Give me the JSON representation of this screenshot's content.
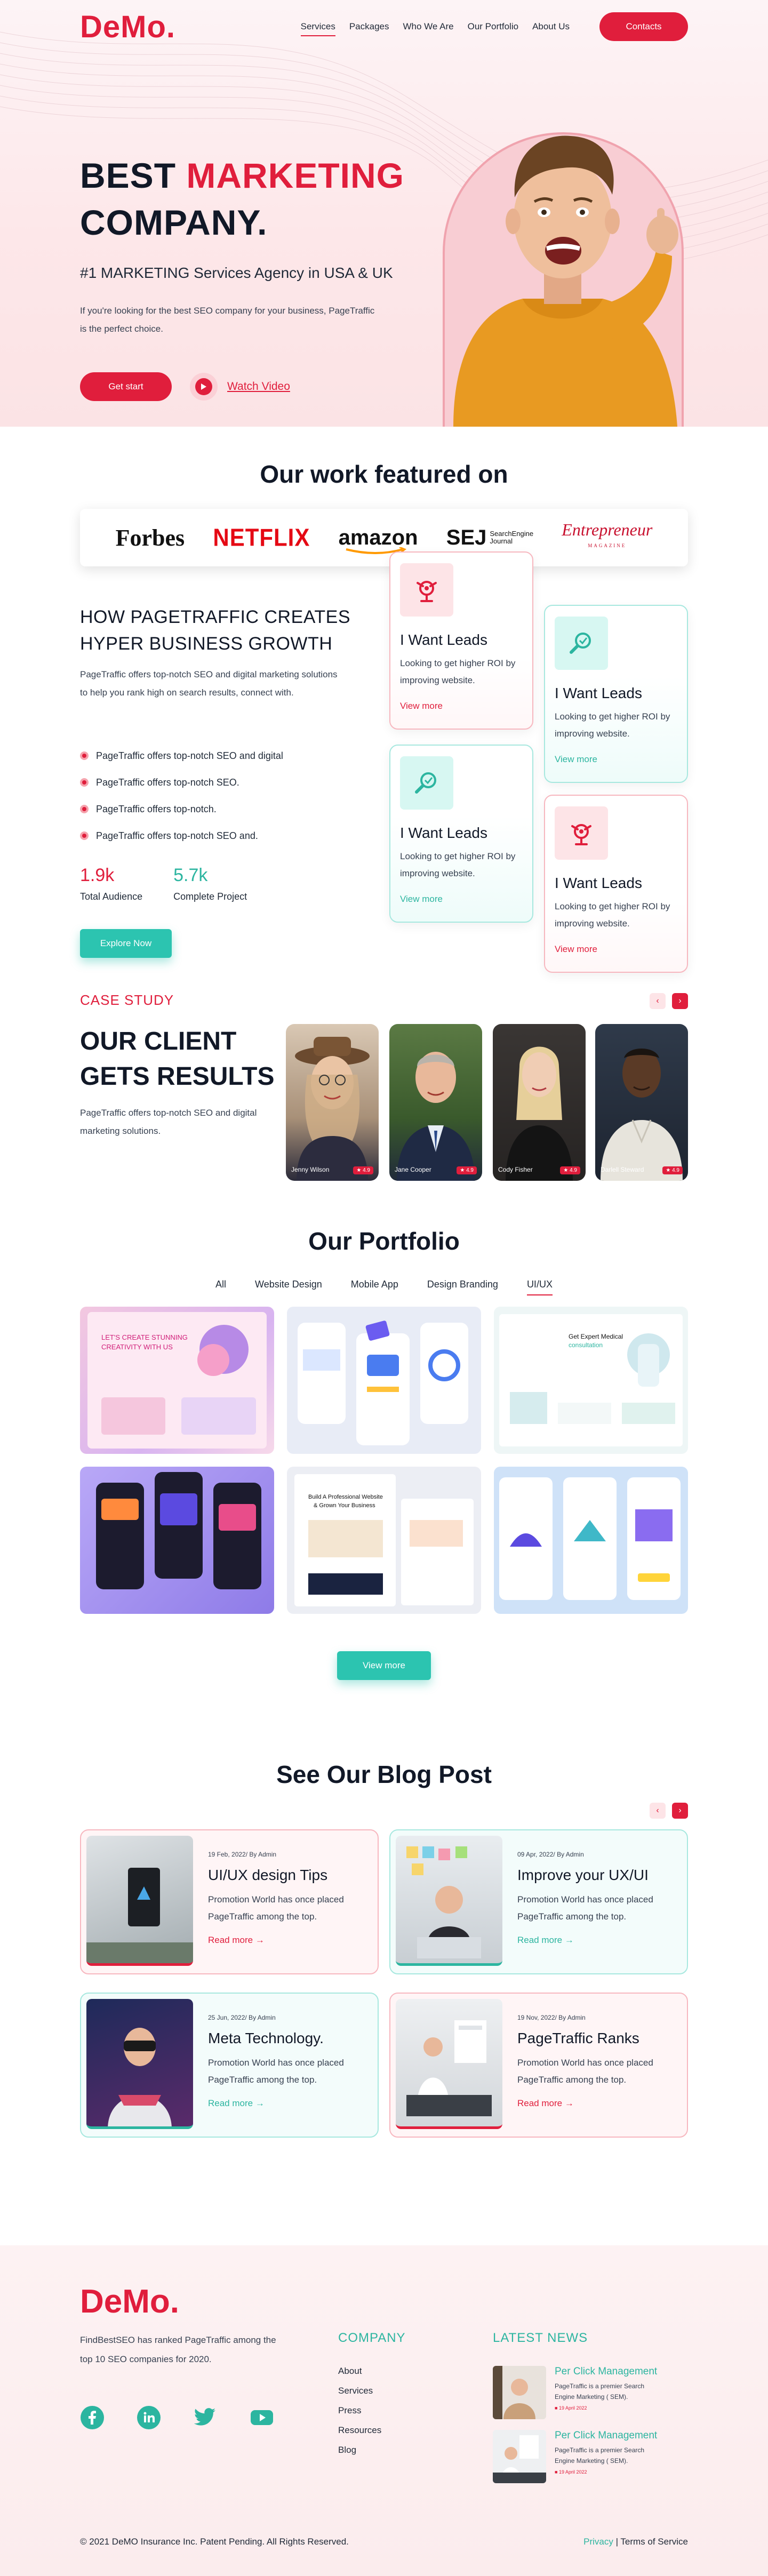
{
  "brand": {
    "logo": "DeMo."
  },
  "nav": {
    "items": [
      "Services",
      "Packages",
      "Who We Are",
      "Our Portfolio",
      "About Us"
    ],
    "contact_label": "Contacts"
  },
  "hero": {
    "title_part1": "BEST ",
    "title_part2": "MARKETING",
    "title_part3": "COMPANY.",
    "subtitle": "#1 MARKETING Services Agency in USA & UK",
    "desc": "If you're looking for the best SEO company for your business, PageTraffic is the perfect choice.",
    "cta": "Get start",
    "watch_label": "Watch Video"
  },
  "featured": {
    "title": "Our work featured on",
    "logos": [
      "Forbes",
      "NETFLIX",
      "amazon",
      "SEJ",
      "Entrepreneur"
    ],
    "sej_line1": "SearchEngine",
    "sej_line2": "Journal",
    "ent_small": "MAGAZINE"
  },
  "growth": {
    "title_line1": "HOW PAGETRAFFIC CREATES",
    "title_line2": "HYPER BUSINESS GROWTH",
    "desc": "PageTraffic offers top-notch SEO and digital marketing solutions to help you rank high on search results, connect with.",
    "bullets": [
      "PageTraffic offers top-notch SEO and digital",
      "PageTraffic offers top-notch SEO.",
      "PageTraffic offers top-notch.",
      "PageTraffic offers top-notch SEO and."
    ],
    "stats": [
      {
        "num": "1.9k",
        "label": "Total Audience"
      },
      {
        "num": "5.7k",
        "label": "Complete Project"
      }
    ],
    "explore": "Explore Now",
    "cards": [
      {
        "title": "I Want Leads",
        "desc": "Looking to get higher ROI by improving website.",
        "link": "View more",
        "theme": "pink"
      },
      {
        "title": "I Want Leads",
        "desc": "Looking to get higher ROI by improving website.",
        "link": "View more",
        "theme": "teal"
      },
      {
        "title": "I Want Leads",
        "desc": "Looking to get higher ROI by improving website.",
        "link": "View more",
        "theme": "teal"
      },
      {
        "title": "I Want Leads",
        "desc": "Looking to get higher ROI by improving website.",
        "link": "View more",
        "theme": "pink"
      }
    ]
  },
  "case_study": {
    "tag": "CASE STUDY",
    "title_line1": "OUR CLIENT",
    "title_line2": "GETS RESULTS",
    "desc": "PageTraffic offers top-notch SEO and digital marketing solutions.",
    "people": [
      {
        "name": "Jenny Wilson",
        "rating": "★ 4.9"
      },
      {
        "name": "Jane Cooper",
        "rating": "★ 4.9"
      },
      {
        "name": "Cody Fisher",
        "rating": "★ 4.9"
      },
      {
        "name": "Darlell Steward",
        "rating": "★ 4.9"
      }
    ]
  },
  "portfolio": {
    "title": "Our Portfolio",
    "filters": [
      "All",
      "Website Design",
      "Mobile App",
      "Design Branding",
      "UI/UX"
    ],
    "card1_text": "LET'S CREATE STUNNING CREATIVITY WITH US",
    "card3_text": "Get Expert Medical consultation",
    "card5_text": "Build A Professional Website & Grown Your Business",
    "view_more": "View more"
  },
  "blog": {
    "title": "See Our Blog Post",
    "posts": [
      {
        "meta": "19 Feb, 2022/ By Admin",
        "title": "UI/UX design Tips",
        "desc": "Promotion World has once placed PageTraffic among the top.",
        "link": "Read more",
        "theme": "pink"
      },
      {
        "meta": "09 Apr, 2022/ By Admin",
        "title": "Improve your UX/UI",
        "desc": "Promotion World has once placed PageTraffic among the top.",
        "link": "Read more",
        "theme": "teal"
      },
      {
        "meta": "25 Jun, 2022/ By Admin",
        "title": "Meta Technology.",
        "desc": "Promotion World has once placed PageTraffic among the top.",
        "link": "Read more",
        "theme": "teal"
      },
      {
        "meta": "19 Nov, 2022/ By Admin",
        "title": "PageTraffic Ranks",
        "desc": "Promotion World has once placed PageTraffic among the top.",
        "link": "Read more",
        "theme": "pink"
      }
    ]
  },
  "footer": {
    "logo": "DeMo.",
    "desc": "FindBestSEO has ranked PageTraffic among the top 10 SEO companies for 2020.",
    "social_icons": [
      "facebook-icon",
      "linkedin-icon",
      "twitter-icon",
      "youtube-icon"
    ],
    "company_title": "COMPANY",
    "company_links": [
      "About",
      "Services",
      "Press",
      "Resources",
      "Blog"
    ],
    "news_title": "LATEST NEWS",
    "news": [
      {
        "title": "Per Click Management",
        "desc": "PageTraffic is a premier Search Engine Marketing ( SEM).",
        "date": "19 April 2022"
      },
      {
        "title": "Per Click Management",
        "desc": "PageTraffic is a premier Search Engine Marketing ( SEM).",
        "date": "19 April 2022"
      }
    ],
    "copyright": "© 2021 DeMO Insurance Inc. Patent Pending. All Rights Reserved.",
    "privacy": "Privacy",
    "separator": " | ",
    "terms": "Terms of Service"
  },
  "colors": {
    "brand_red": "#e01e3c",
    "brand_teal": "#2cb5a0",
    "hero_bg": "#fde7e9"
  }
}
